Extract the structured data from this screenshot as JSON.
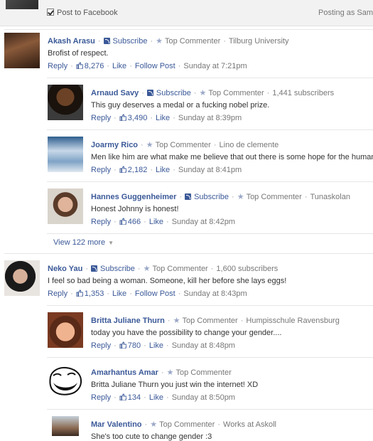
{
  "composer": {
    "post_to_facebook": "Post to Facebook",
    "posting_as": "Posting as Sam T"
  },
  "labels": {
    "subscribe": "Subscribe",
    "top_commenter": "Top Commenter",
    "reply": "Reply",
    "like": "Like",
    "follow_post": "Follow Post"
  },
  "comments": [
    {
      "name": "Akash Arasu",
      "subscribe": true,
      "badge": "Top Commenter",
      "extra": "Tilburg University",
      "text": "Brofist of respect.",
      "likes": "8,276",
      "follow": true,
      "time": "Sunday at 7:21pm"
    },
    {
      "name": "Arnaud Savy",
      "subscribe": true,
      "badge": "Top Commenter",
      "extra": "1,441 subscribers",
      "text": "This guy deserves a medal or a fucking nobel prize.",
      "likes": "3,490",
      "follow": false,
      "time": "Sunday at 8:39pm"
    },
    {
      "name": "Joarmy Rico",
      "subscribe": false,
      "badge": "Top Commenter",
      "extra": "Lino de clemente",
      "text": "Men like him are what make me believe that out there is some hope for the humanit",
      "likes": "2,182",
      "follow": false,
      "time": "Sunday at 8:41pm"
    },
    {
      "name": "Hannes Guggenheimer",
      "subscribe": true,
      "badge": "Top Commenter",
      "extra": "Tunaskolan",
      "text": "Honest Johnny is honest!",
      "likes": "466",
      "follow": false,
      "time": "Sunday at 8:42pm"
    },
    {
      "name": "Neko Yau",
      "subscribe": true,
      "badge": "Top Commenter",
      "extra": "1,600 subscribers",
      "text": "I feel so bad being a woman. Someone, kill her before she lays eggs!",
      "likes": "1,353",
      "follow": true,
      "time": "Sunday at 8:43pm"
    },
    {
      "name": "Britta Juliane Thurn",
      "subscribe": false,
      "badge": "Top Commenter",
      "extra": "Humpisschule Ravensburg",
      "text": "today you have the possibility to change your gender....",
      "likes": "780",
      "follow": false,
      "time": "Sunday at 8:48pm"
    },
    {
      "name": "Amarhantus Amar",
      "subscribe": false,
      "badge": "Top Commenter",
      "extra": "",
      "text": "Britta Juliane Thurn you just win the internet! XD",
      "likes": "134",
      "follow": false,
      "time": "Sunday at 8:50pm"
    },
    {
      "name": "Mar Valentino",
      "subscribe": false,
      "badge": "Top Commenter",
      "extra": "Works at Askoll",
      "text": "She's too cute to change gender :3",
      "likes": "",
      "follow": false,
      "time": ""
    }
  ],
  "view_more": "View 122 more",
  "icons": {
    "checkbox": "checkbox-checked-icon",
    "subscribe": "rss-subscribe-icon",
    "badge": "star-icon",
    "likes": "thumbs-up-icon",
    "more": "caret-down-icon"
  },
  "colors": {
    "link": "#3b5998",
    "meta": "#777777",
    "divider": "#e6e6e6",
    "composer_bg": "#f2f2f2"
  }
}
